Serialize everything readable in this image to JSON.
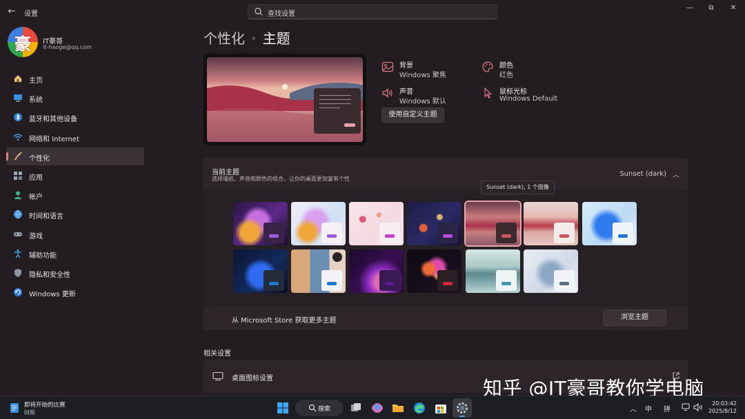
{
  "window": {
    "title": "设置",
    "search_placeholder": "查找设置",
    "controls": {
      "minimize": "—",
      "maximize": "⧉",
      "close": "✕"
    }
  },
  "user": {
    "avatar_char": "豪",
    "name": "IT豪哥",
    "email": "it-haoge@qq.com"
  },
  "sidebar": {
    "items": [
      {
        "label": "主页",
        "icon": "home-icon"
      },
      {
        "label": "系统",
        "icon": "system-icon"
      },
      {
        "label": "蓝牙和其他设备",
        "icon": "bluetooth-icon"
      },
      {
        "label": "网络和 Internet",
        "icon": "wifi-icon"
      },
      {
        "label": "个性化",
        "icon": "brush-icon",
        "active": true
      },
      {
        "label": "应用",
        "icon": "apps-icon"
      },
      {
        "label": "帐户",
        "icon": "account-icon"
      },
      {
        "label": "时间和语言",
        "icon": "globe-icon"
      },
      {
        "label": "游戏",
        "icon": "gamepad-icon"
      },
      {
        "label": "辅助功能",
        "icon": "accessibility-icon"
      },
      {
        "label": "隐私和安全性",
        "icon": "shield-icon"
      },
      {
        "label": "Windows 更新",
        "icon": "update-icon"
      }
    ]
  },
  "breadcrumb": {
    "parent": "个性化",
    "separator": "›",
    "current": "主题"
  },
  "theme_props": {
    "background": {
      "title": "背景",
      "value": "Windows 聚焦"
    },
    "color": {
      "title": "颜色",
      "value": "红色"
    },
    "sound": {
      "title": "声音",
      "value": "Windows 默认"
    },
    "cursor": {
      "title": "鼠标光标",
      "value": "Windows Default"
    },
    "custom_button": "使用自定义主题"
  },
  "current_theme": {
    "title": "当前主题",
    "subtitle": "选择墙纸、声音和颜色的组合，让你的桌面更加富有个性",
    "value": "Sunset (dark)",
    "tooltip": "Sunset (dark), 1 个图像",
    "selected_index": 4
  },
  "store": {
    "label": "从 Microsoft Store 获取更多主题",
    "button": "浏览主题"
  },
  "related": {
    "heading": "相关设置",
    "desktop_icons": "桌面图标设置"
  },
  "watermark": "知乎 @IT豪哥教你学电脑",
  "taskbar": {
    "news_title": "即将开始的比赛",
    "news_sub": "财报",
    "search_label": "搜索",
    "ime_lang": "中",
    "ime_mode": "拼",
    "time": "20:03:42",
    "date": "2025/8/12"
  },
  "colors": {
    "accent": "#e07b82",
    "background": "#231c20",
    "card": "#2d2529"
  }
}
